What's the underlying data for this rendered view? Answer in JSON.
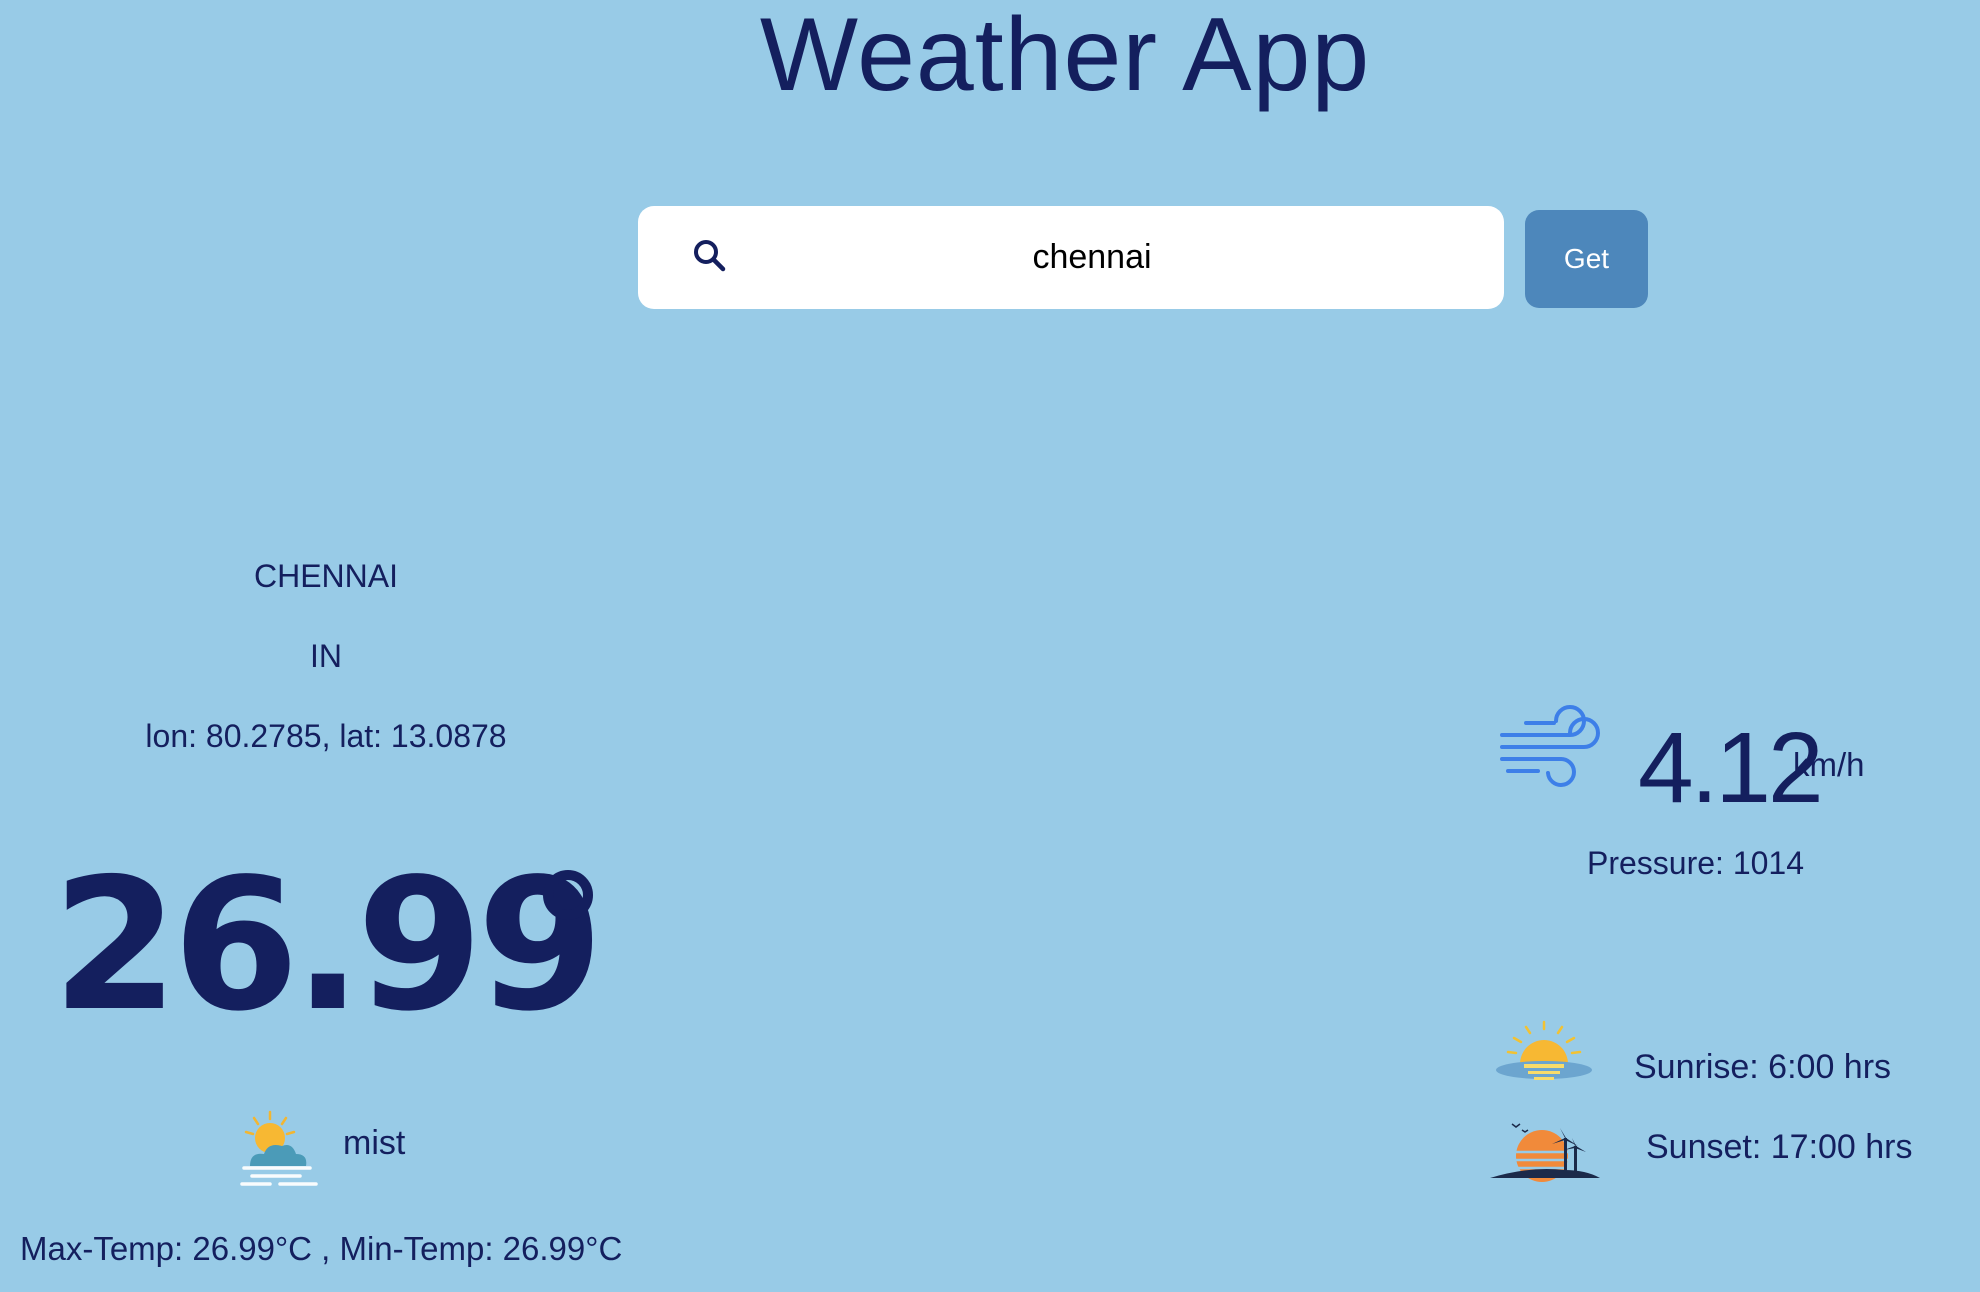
{
  "header": {
    "title": "Weather App"
  },
  "search": {
    "value": "chennai",
    "button_label": "Get",
    "icon": "search-icon"
  },
  "location": {
    "city": "CHENNAI",
    "country": "IN",
    "coords": "lon: 80.2785, lat: 13.0878"
  },
  "current": {
    "temperature": "26.99",
    "condition": "mist",
    "condition_icon": "mist-icon",
    "minmax": "Max-Temp: 26.99°C , Min-Temp: 26.99°C"
  },
  "wind": {
    "speed": "4.12",
    "unit": "km/h",
    "icon": "wind-icon",
    "pressure": "Pressure: 1014"
  },
  "sun": {
    "sunrise": "Sunrise: 6:00 hrs",
    "sunset": "Sunset: 17:00 hrs",
    "sunrise_icon": "sunrise-icon",
    "sunset_icon": "sunset-icon"
  },
  "colors": {
    "background": "#98cbe7",
    "text": "#141f5e",
    "button": "#4d87bb",
    "wind_icon": "#3d7fe8"
  }
}
